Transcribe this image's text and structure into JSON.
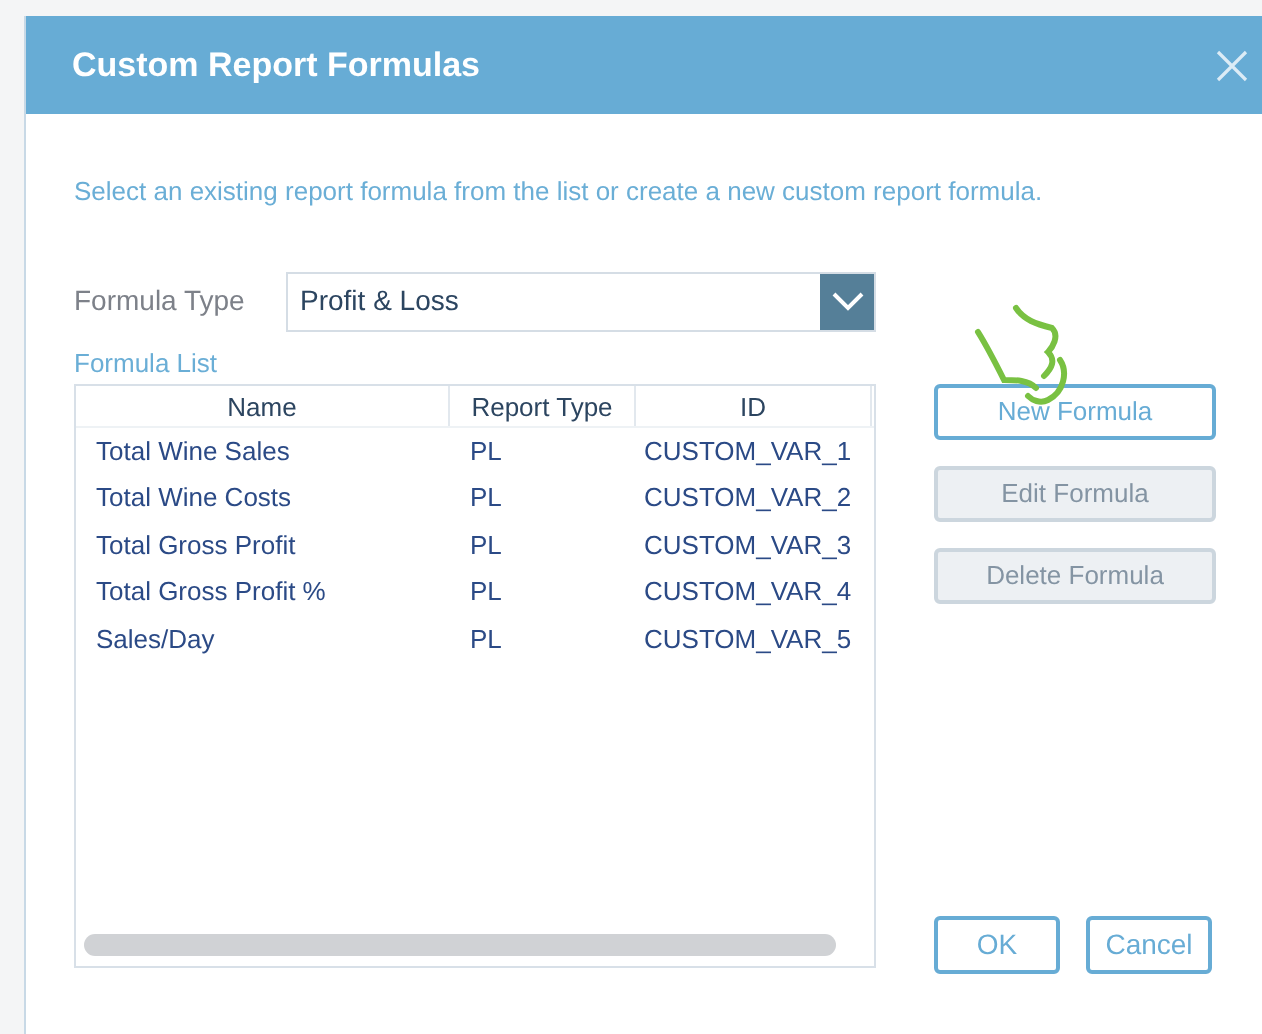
{
  "dialog": {
    "title": "Custom Report Formulas",
    "instruction": "Select an existing report formula from the list or create a new custom report formula.",
    "formula_type": {
      "label": "Formula Type",
      "value": "Profit & Loss"
    },
    "list_label": "Formula List",
    "table": {
      "columns": [
        "Name",
        "Report Type",
        "ID"
      ],
      "rows": [
        [
          "Total Wine Sales",
          "PL",
          "CUSTOM_VAR_1"
        ],
        [
          "Total Wine Costs",
          "PL",
          "CUSTOM_VAR_2"
        ],
        [
          "Total Gross Profit",
          "PL",
          "CUSTOM_VAR_3"
        ],
        [
          "Total Gross Profit %",
          "PL",
          "CUSTOM_VAR_4"
        ],
        [
          "Sales/Day",
          "PL",
          "CUSTOM_VAR_5"
        ]
      ]
    },
    "actions": [
      {
        "label": "New Formula",
        "disabled": false
      },
      {
        "label": "Edit Formula",
        "disabled": true
      },
      {
        "label": "Delete Formula",
        "disabled": true
      }
    ],
    "footer_buttons": [
      "OK",
      "Cancel"
    ]
  }
}
